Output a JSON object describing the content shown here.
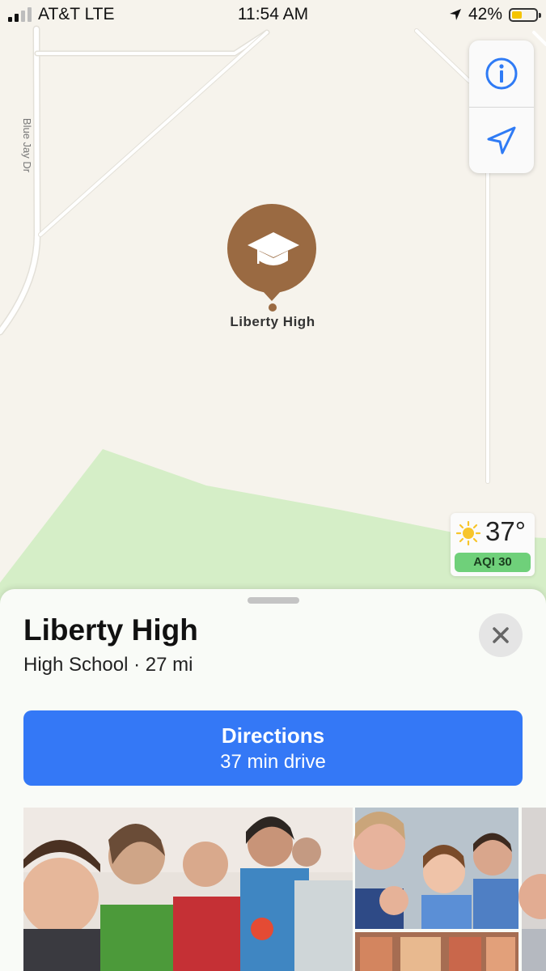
{
  "status_bar": {
    "carrier": "AT&T LTE",
    "time": "11:54 AM",
    "battery_percent": "42%",
    "battery_level": 0.42
  },
  "map": {
    "road_name": "Blue Jay Dr",
    "pin": {
      "label": "Liberty High",
      "icon": "graduation-cap-icon",
      "color": "#9a6a42"
    },
    "controls": {
      "info_icon": "info-icon",
      "location_icon": "location-arrow-icon"
    },
    "weather": {
      "icon": "sun-icon",
      "temperature": "37°",
      "aqi": "AQI 30"
    }
  },
  "place_card": {
    "title": "Liberty High",
    "subtitle": "High School · 27 mi",
    "close_icon": "close-icon",
    "directions": {
      "label": "Directions",
      "detail": "37 min drive",
      "color": "#3478f6"
    }
  }
}
